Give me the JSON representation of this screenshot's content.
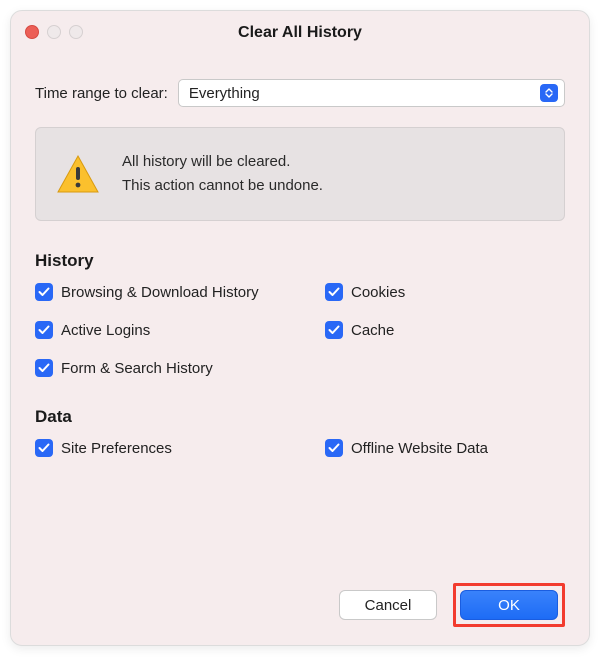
{
  "title": "Clear All History",
  "timeRange": {
    "label": "Time range to clear:",
    "value": "Everything"
  },
  "warning": {
    "line1": "All history will be cleared.",
    "line2": "This action cannot be undone."
  },
  "sections": {
    "history": {
      "heading": "History",
      "items": [
        {
          "label": "Browsing & Download History",
          "checked": true
        },
        {
          "label": "Cookies",
          "checked": true
        },
        {
          "label": "Active Logins",
          "checked": true
        },
        {
          "label": "Cache",
          "checked": true
        },
        {
          "label": "Form & Search History",
          "checked": true
        }
      ]
    },
    "data": {
      "heading": "Data",
      "items": [
        {
          "label": "Site Preferences",
          "checked": true
        },
        {
          "label": "Offline Website Data",
          "checked": true
        }
      ]
    }
  },
  "buttons": {
    "cancel": "Cancel",
    "ok": "OK"
  }
}
